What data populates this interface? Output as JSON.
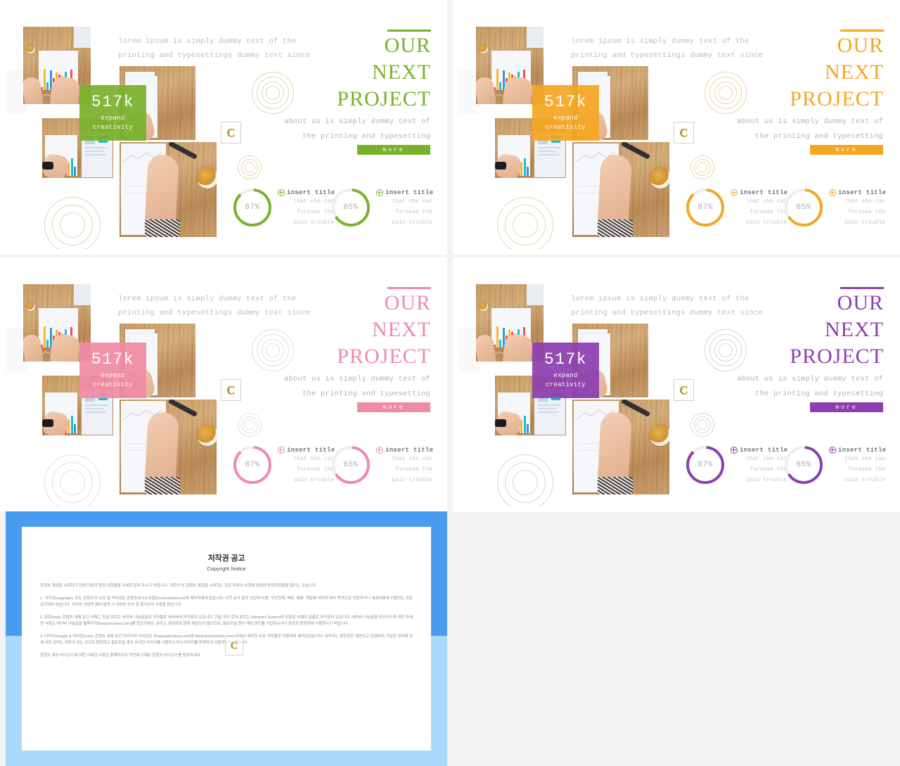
{
  "meta": {
    "slide_count": 4,
    "bg_color": "#f2f3f5"
  },
  "slides": [
    {
      "id": "slide-green",
      "accent": "#7ab12c",
      "accent_soft": "#e8eed9",
      "ring_color": "#ded6b4",
      "lead_line1": "lorem ipsum is simply dummy text of the",
      "lead_line2": "printing and typesettings dummy text since",
      "title_line1": "OUR",
      "title_line2": "NEXT",
      "title_line3": "PROJECT",
      "about_line1": "about us is simply dummy text of",
      "about_line2": "the printing and typesetting",
      "more_label": "more",
      "stat_number": "517k",
      "stat_sub_line1": "expand",
      "stat_sub_line2": "creativity",
      "badge_letter": "C",
      "stats": [
        {
          "percent": 87,
          "percent_label": "87%",
          "title": "insert title",
          "desc_line1": "that she can",
          "desc_line2": "foresee the",
          "desc_line3": "pain trouble"
        },
        {
          "percent": 65,
          "percent_label": "65%",
          "title": "insert title",
          "desc_line1": "that she can",
          "desc_line2": "foresee the",
          "desc_line3": "pain trouble"
        }
      ]
    },
    {
      "id": "slide-orange",
      "accent": "#f5a623",
      "accent_soft": "#fbe9c4",
      "ring_color": "#e7d7a8",
      "lead_line1": "lorem ipsum is simply dummy text of the",
      "lead_line2": "printing and typesettings dummy text since",
      "title_line1": "OUR",
      "title_line2": "NEXT",
      "title_line3": "PROJECT",
      "about_line1": "about us is simply dummy text of",
      "about_line2": "the printing and typesetting",
      "more_label": "more",
      "stat_number": "517k",
      "stat_sub_line1": "expand",
      "stat_sub_line2": "creativity",
      "badge_letter": "C",
      "stats": [
        {
          "percent": 87,
          "percent_label": "87%",
          "title": "insert title",
          "desc_line1": "that she can",
          "desc_line2": "foresee the",
          "desc_line3": "pain trouble"
        },
        {
          "percent": 65,
          "percent_label": "65%",
          "title": "insert title",
          "desc_line1": "that she can",
          "desc_line2": "foresee the",
          "desc_line3": "pain trouble"
        }
      ]
    },
    {
      "id": "slide-pink",
      "accent": "#f08ba5",
      "accent_soft": "#f8d3dc",
      "ring_color": "#e6dde0",
      "lead_line1": "lorem ipsum is simply dummy text of the",
      "lead_line2": "printing and typesettings dummy text since",
      "title_line1": "OUR",
      "title_line2": "NEXT",
      "title_line3": "PROJECT",
      "about_line1": "about us is simply dummy text of",
      "about_line2": "the printing and typesetting",
      "more_label": "more",
      "stat_number": "517k",
      "stat_sub_line1": "expand",
      "stat_sub_line2": "creativity",
      "badge_letter": "C",
      "stats": [
        {
          "percent": 87,
          "percent_label": "87%",
          "title": "insert title",
          "desc_line1": "that she can",
          "desc_line2": "foresee the",
          "desc_line3": "pain trouble"
        },
        {
          "percent": 65,
          "percent_label": "65%",
          "title": "insert title",
          "desc_line1": "that she can",
          "desc_line2": "foresee the",
          "desc_line3": "pain trouble"
        }
      ]
    },
    {
      "id": "slide-purple",
      "accent": "#8d3fb0",
      "accent_soft": "#e0c8ec",
      "ring_color": "#d9d2de",
      "lead_line1": "lorem ipsum is simply dummy text of the",
      "lead_line2": "printing and typesettings dummy text since",
      "title_line1": "OUR",
      "title_line2": "NEXT",
      "title_line3": "PROJECT",
      "about_line1": "about us is simply dummy text of",
      "about_line2": "the printing and typesetting",
      "more_label": "more",
      "stat_number": "517k",
      "stat_sub_line1": "expand",
      "stat_sub_line2": "creativity",
      "badge_letter": "C",
      "stats": [
        {
          "percent": 87,
          "percent_label": "87%",
          "title": "insert title",
          "desc_line1": "that she can",
          "desc_line2": "foresee the",
          "desc_line3": "pain trouble"
        },
        {
          "percent": 65,
          "percent_label": "65%",
          "title": "insert title",
          "desc_line1": "that she can",
          "desc_line2": "foresee the",
          "desc_line3": "pain trouble"
        }
      ]
    }
  ],
  "copyright": {
    "accent_top": "#4a9cf0",
    "accent_bottom": "#a9d9f8",
    "title_ko": "저작권 공고",
    "title_en": "Copyright Notice",
    "badge_letter": "C",
    "intro": "콘텐츠 제공을 시작하기 전에 다음의 합의 사항들을 자세히 읽어 주시기 바랍니다. 귀하가 이 콘텐츠 제공을 시작하는 것은 아래의 사항에 보증에 동의하셨음을 알리는 것입니다.",
    "p1": "1. 저작권(copyright): 모든 콘텐츠의 소유 및 저작권은 콘텐츠위너스닷컴(Contentstakeout)에 제작자에게 있습니다. 사전 승낙 없이 상업적 이용, 무단전재, 배포, 복제, 개발에 의하여 영리 목적으로 이용하거나 제삼자에게 이용하는 것은 금지되어 있습니다. 이러한 상업적 행위 발견 시 관련된 민사 및 형사상의 사항을 받습니다.",
    "p2": "2. 폰트(font): 콘텐츠 내에 담긴 서체는 한글 폰트는 네이버 나눔글꼴의 저작물로 네이버에 저작권이 있습니다. 한글 외의 로마 폰트는 Windows System에 포함된 서체의 글꼴로 저작권이 있습니다. 네이버 나눔글꼴 라이선스에 대한 자세한 사항은 네이버 나눔글꼴 홈페이지(hangeul.naver.com)를 참조하세요. 폰트는 콘텐츠와 함께 제공되지 않으므로, 필요하실 경우 해당 폰트를 구입하시거나 폰트로 변경하여 사용하시기 바랍니다.",
    "p3": "3. 이미지(image) & 아이콘(icon): 콘텐츠 내에 담긴 이미지와 아이콘은 Pixabay(pixabay.com)와 Webalys(webalys.com) 측에서 제공한 무료 저작물로 이용하여 제작되었습니다. 이미지는 참조로만 제공되고 콘텐츠의 구입한 것이며 이에 대한 권리는 귀하가 갖는 것으로 확인하고 필요하실 경우 유사한 이미지를 사용하시거나 이미지를 변경하여 사용하시기 바랍니다.",
    "outro": "콘텐츠 제공 라이선스에 대한 자세한 사항은 홈페이지의 하단에 기재된 콘텐츠 라이선스를 참조하세요."
  }
}
